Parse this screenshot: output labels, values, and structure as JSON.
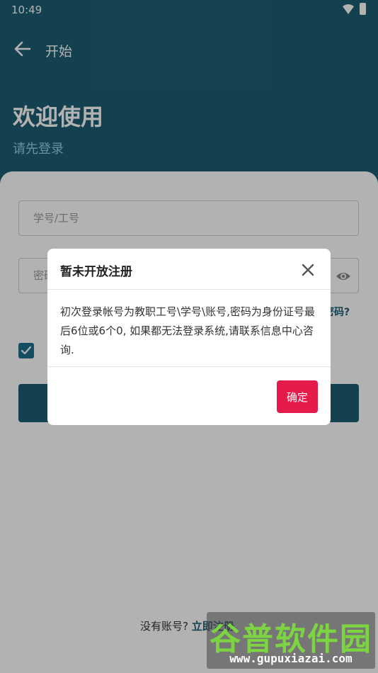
{
  "status_bar": {
    "time": "10:49"
  },
  "app_bar": {
    "title": "开始"
  },
  "header": {
    "welcome": "欢迎使用",
    "subtitle": "请先登录"
  },
  "form": {
    "id_placeholder": "学号/工号",
    "password_placeholder": "密码",
    "forgot_password": "忘记密码?",
    "remember_checked": true
  },
  "footer": {
    "no_account": "没有账号?",
    "register_link": "立即注册"
  },
  "dialog": {
    "title": "暂未开放注册",
    "body": "初次登录帐号为教职工号\\学号\\账号,密码为身份证号最后6位或6个0, 如果都无法登录系统,请联系信息中心咨询.",
    "confirm_label": "确定"
  },
  "watermark": {
    "brand": "谷普软件园",
    "url": "www.gupuxiazai.com"
  },
  "colors": {
    "primary": "#1e5d72",
    "subtitle": "#8fd3e8",
    "confirm": "#e51c4b",
    "checkbox": "#1e6f8c"
  },
  "icons": {
    "back": "arrow-left-icon",
    "close": "close-icon",
    "eye": "eye-icon",
    "check": "check-icon",
    "wifi": "wifi-icon",
    "battery": "battery-icon"
  }
}
